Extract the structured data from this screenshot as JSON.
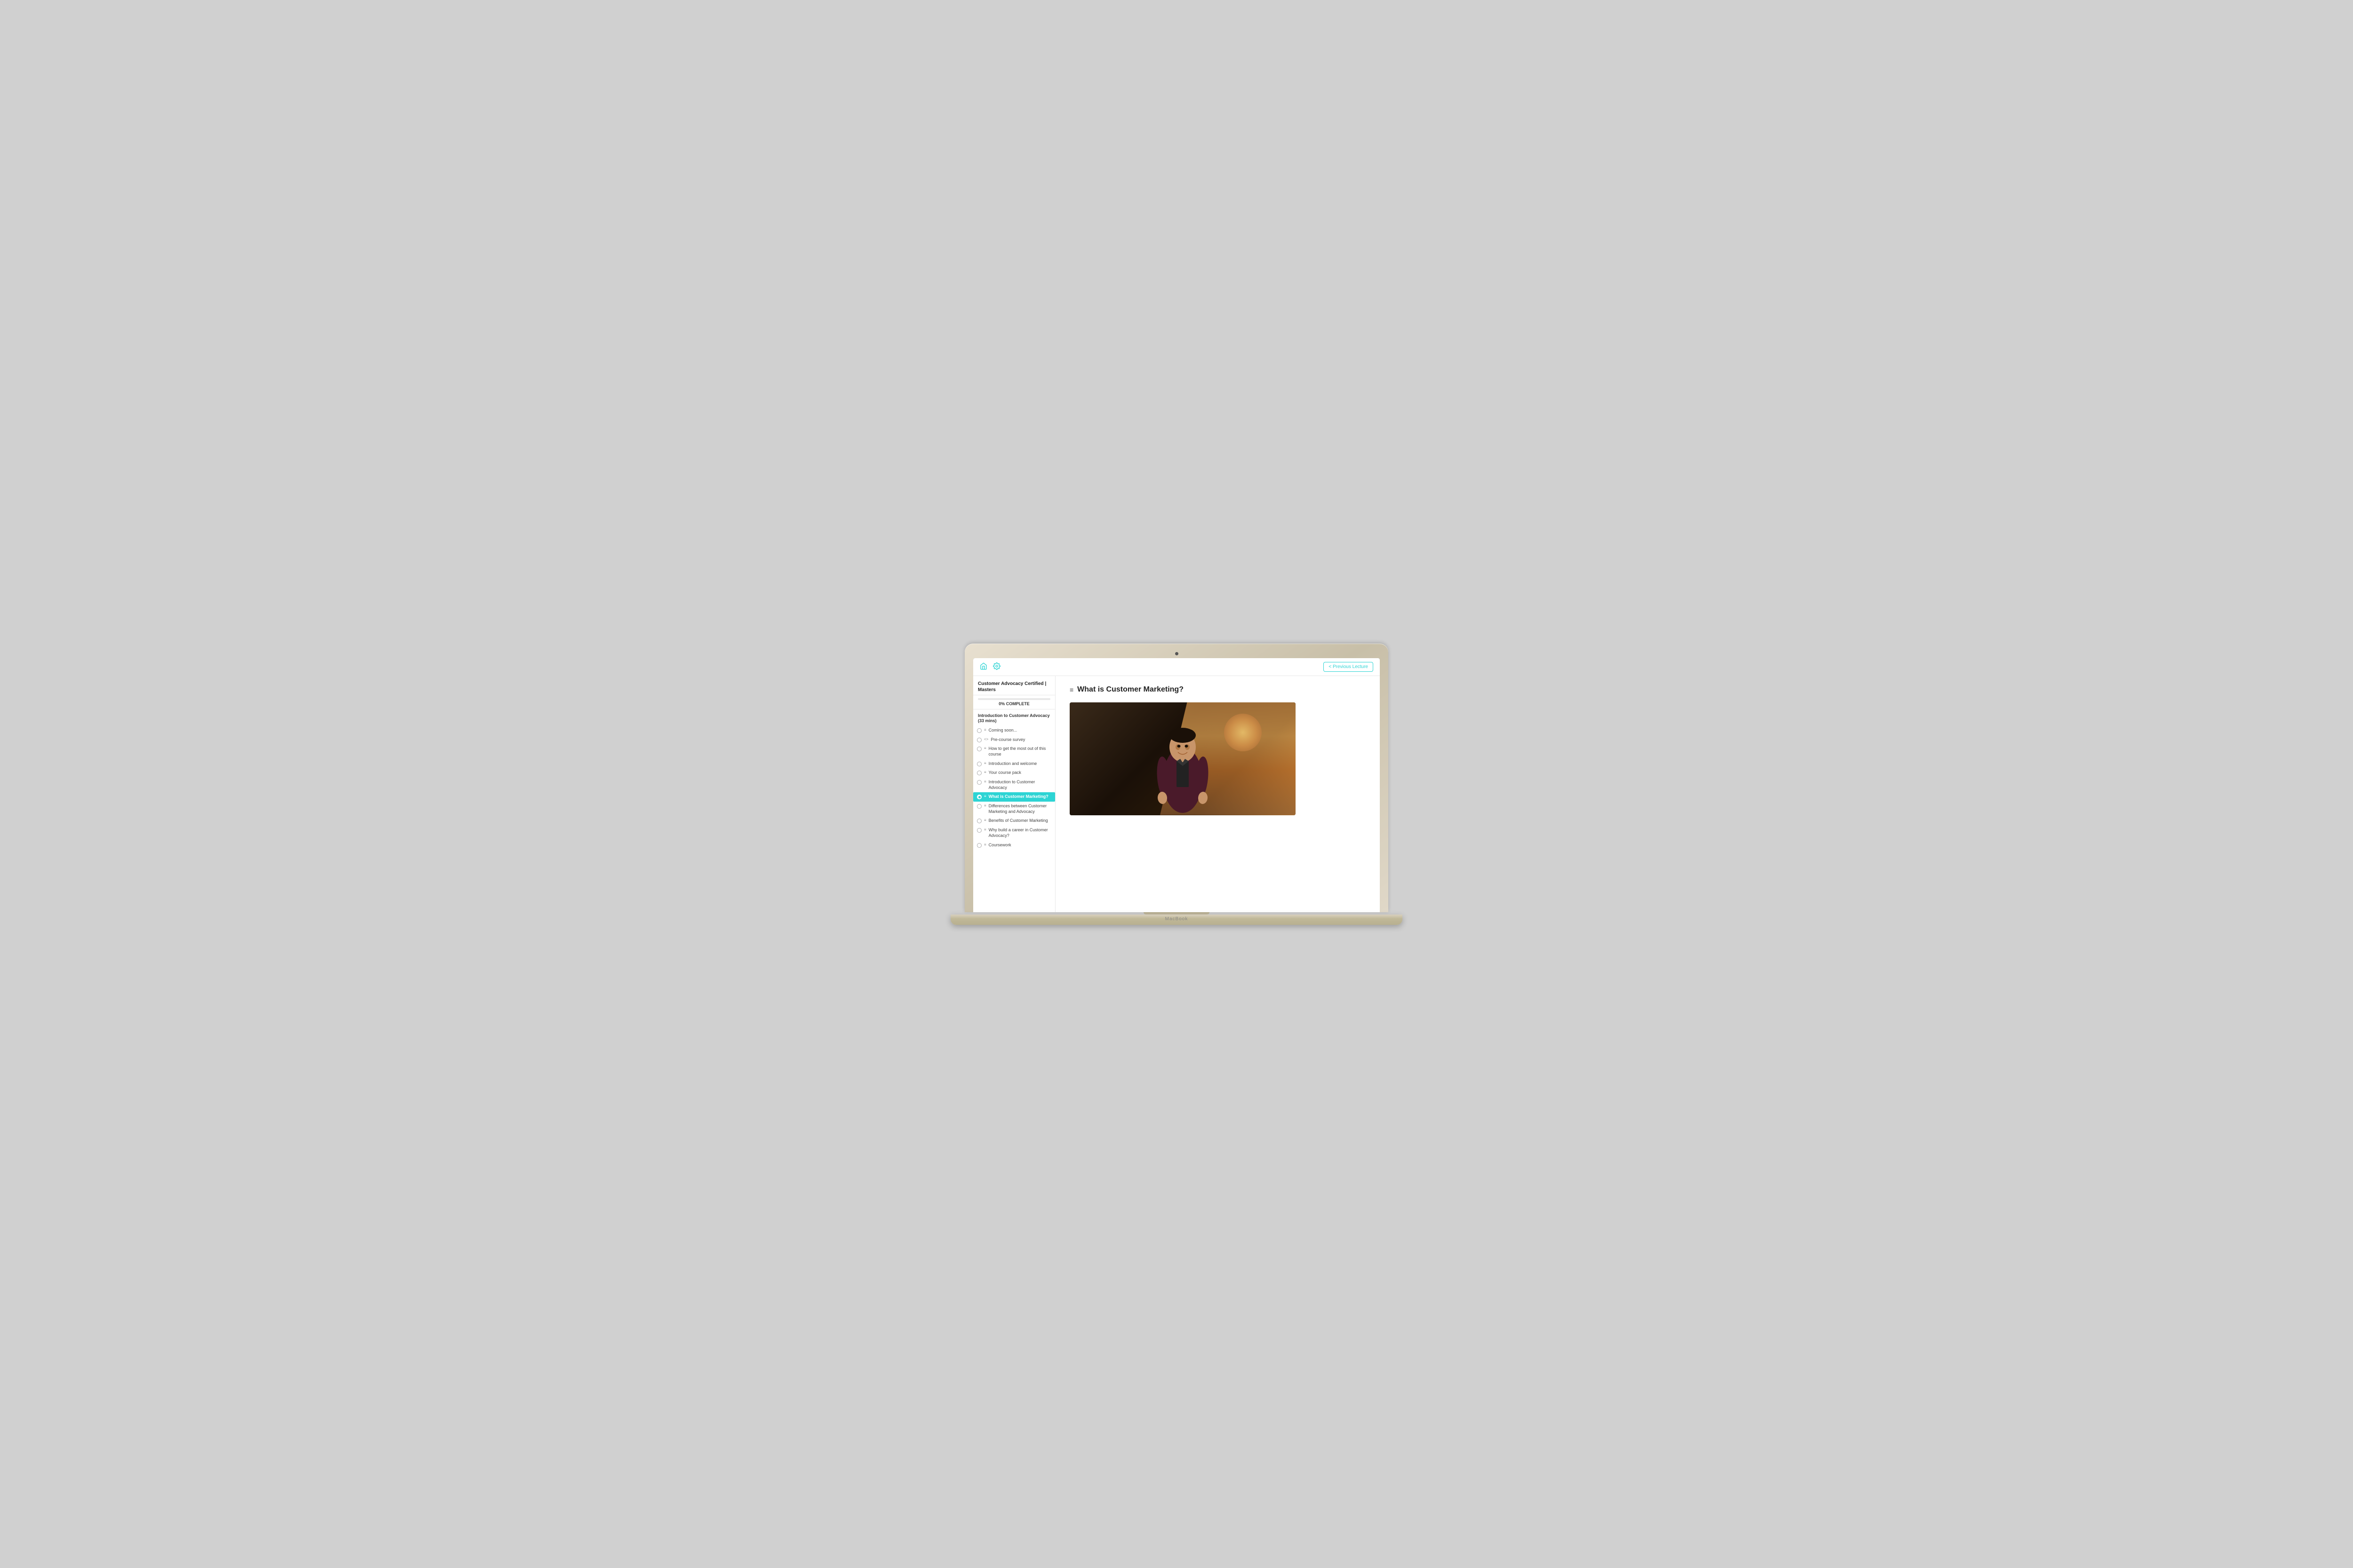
{
  "app": {
    "title": "What is Customer Marketing?"
  },
  "header": {
    "prev_button": "< Previous Lecture",
    "home_icon": "home",
    "settings_icon": "settings"
  },
  "sidebar": {
    "course_title": "Customer Advocacy Certified | Masters",
    "progress_percent": "0%",
    "progress_label": "COMPLETE",
    "section_title": "Introduction to Customer Advocacy (33 mins)",
    "items": [
      {
        "id": "coming-soon",
        "label": "Coming soon...",
        "icon": "≡",
        "active": false
      },
      {
        "id": "pre-course-survey",
        "label": "Pre-course survey",
        "icon": "<>",
        "active": false
      },
      {
        "id": "how-to-get-most",
        "label": "How to get the most out of this course",
        "icon": "≡",
        "active": false
      },
      {
        "id": "intro-welcome",
        "label": "Introduction and welcome",
        "icon": "≡",
        "active": false
      },
      {
        "id": "your-course-pack",
        "label": "Your course pack",
        "icon": "≡",
        "active": false
      },
      {
        "id": "intro-customer-advocacy",
        "label": "Introduction to Customer Advocacy",
        "icon": "≡",
        "active": false
      },
      {
        "id": "what-is-customer-marketing",
        "label": "What is Customer Marketing?",
        "icon": "≡",
        "active": true
      },
      {
        "id": "differences",
        "label": "Differences between Customer Marketing and Advocacy",
        "icon": "≡",
        "active": false
      },
      {
        "id": "benefits",
        "label": "Benefits of Customer Marketing",
        "icon": "≡",
        "active": false
      },
      {
        "id": "why-build-career",
        "label": "Why build a career in Customer Advocacy?",
        "icon": "≡",
        "active": false
      },
      {
        "id": "coursework",
        "label": "Coursework",
        "icon": "≡",
        "active": false
      }
    ]
  },
  "content": {
    "lecture_icon": "≡",
    "lecture_title": "What is Customer Marketing?"
  }
}
